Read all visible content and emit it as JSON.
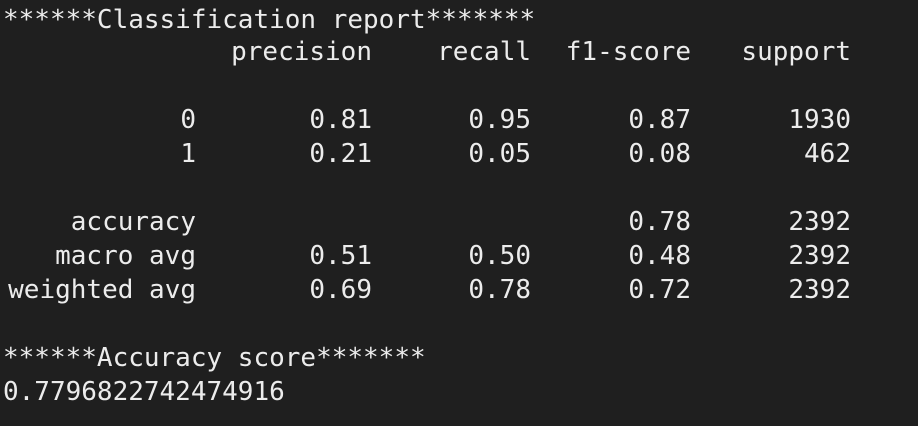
{
  "report_header": "******Classification report*******",
  "columns": [
    "precision",
    "recall",
    "f1-score",
    "support"
  ],
  "rows": [
    {
      "label": "0",
      "precision": "0.81",
      "recall": "0.95",
      "f1": "0.87",
      "support": "1930"
    },
    {
      "label": "1",
      "precision": "0.21",
      "recall": "0.05",
      "f1": "0.08",
      "support": "462"
    },
    {
      "label": "accuracy",
      "precision": "",
      "recall": "",
      "f1": "0.78",
      "support": "2392"
    },
    {
      "label": "macro avg",
      "precision": "0.51",
      "recall": "0.50",
      "f1": "0.48",
      "support": "2392"
    },
    {
      "label": "weighted avg",
      "precision": "0.69",
      "recall": "0.78",
      "f1": "0.72",
      "support": "2392"
    }
  ],
  "accuracy_header": "******Accuracy score*******",
  "accuracy_value": "0.7796822742474916"
}
